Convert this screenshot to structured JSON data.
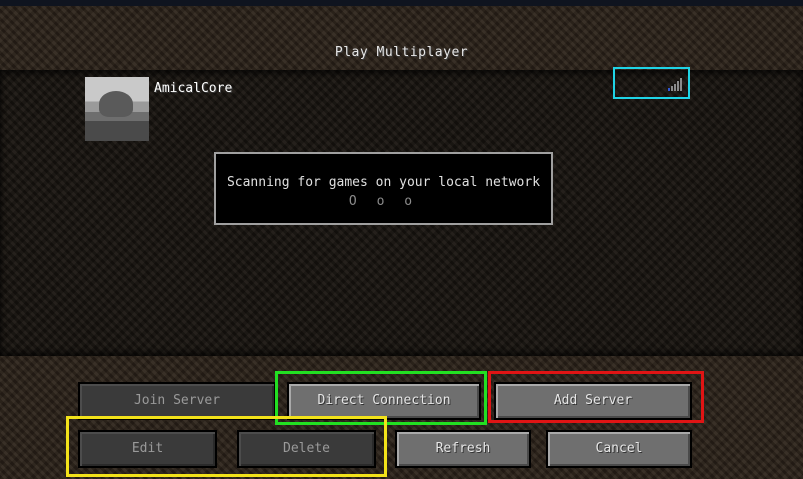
{
  "screen": {
    "title": "Play Multiplayer"
  },
  "servers": [
    {
      "name": "AmicalCore",
      "ping_bars_lit": 1,
      "ping_bars_total": 5
    }
  ],
  "lan_scan": {
    "message": "Scanning for games on your local network",
    "progress_dots": "O o o"
  },
  "buttons": {
    "join_server": "Join Server",
    "direct_connection": "Direct Connection",
    "add_server": "Add Server",
    "edit": "Edit",
    "delete": "Delete",
    "refresh": "Refresh",
    "cancel": "Cancel"
  },
  "highlight_colors": {
    "ping": "#1fd4e6",
    "direct_connection": "#22e022",
    "add_server": "#e01414",
    "edit_delete": "#f2e21a"
  }
}
